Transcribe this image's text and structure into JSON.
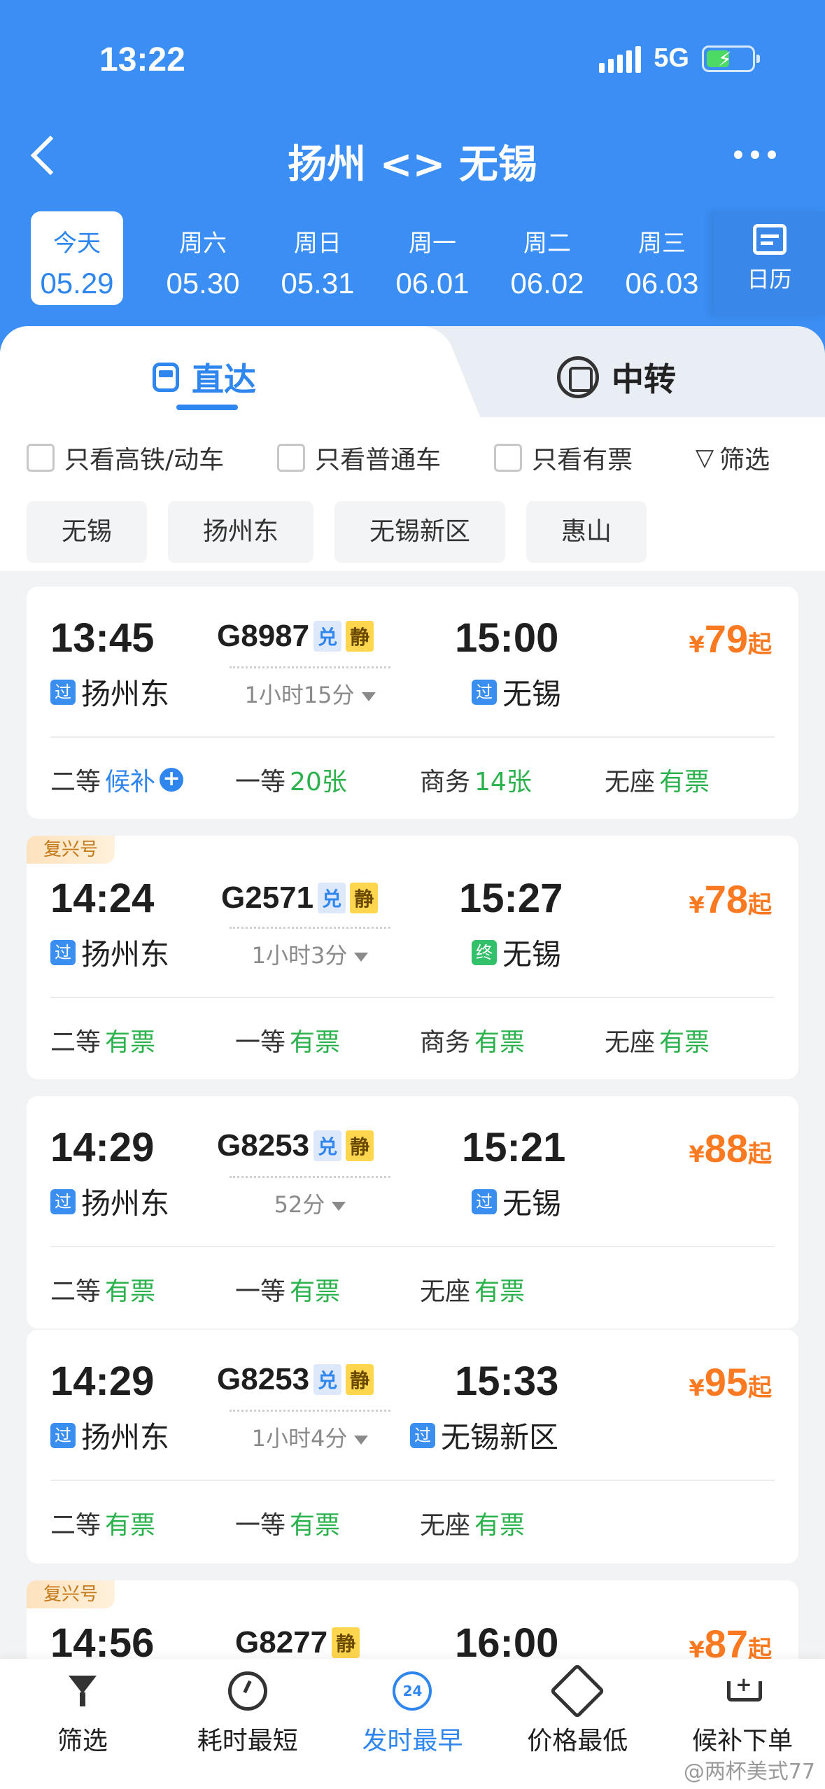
{
  "status": {
    "time": "13:22",
    "network": "5G"
  },
  "header": {
    "title": "扬州 <> 无锡"
  },
  "dates": [
    {
      "weekday": "今天",
      "date": "05.29"
    },
    {
      "weekday": "周六",
      "date": "05.30"
    },
    {
      "weekday": "周日",
      "date": "05.31"
    },
    {
      "weekday": "周一",
      "date": "06.01"
    },
    {
      "weekday": "周二",
      "date": "06.02"
    },
    {
      "weekday": "周三",
      "date": "06.03"
    }
  ],
  "calendar_label": "日历",
  "tabs": {
    "direct": "直达",
    "transfer": "中转"
  },
  "filters": {
    "highspeed": "只看高铁/动车",
    "normal": "只看普通车",
    "available": "只看有票",
    "filter": "筛选"
  },
  "stations": [
    "无锡",
    "扬州东",
    "无锡新区",
    "惠山"
  ],
  "tag_labels": {
    "dui": "兑",
    "jing": "静",
    "fuxing": "复兴号",
    "pass": "过",
    "end": "终",
    "qi": "起",
    "currency": "¥"
  },
  "trains": [
    {
      "dep": "13:45",
      "no": "G8987",
      "arr": "15:00",
      "price": "79",
      "from": "扬州东",
      "to": "无锡",
      "duration": "1小时15分",
      "seats": [
        {
          "cls": "二等",
          "st": "候补"
        },
        {
          "cls": "一等",
          "st": "20张"
        },
        {
          "cls": "商务",
          "st": "14张"
        },
        {
          "cls": "无座",
          "st": "有票"
        }
      ]
    },
    {
      "dep": "14:24",
      "no": "G2571",
      "arr": "15:27",
      "price": "78",
      "from": "扬州东",
      "to": "无锡",
      "duration": "1小时3分",
      "seats": [
        {
          "cls": "二等",
          "st": "有票"
        },
        {
          "cls": "一等",
          "st": "有票"
        },
        {
          "cls": "商务",
          "st": "有票"
        },
        {
          "cls": "无座",
          "st": "有票"
        }
      ]
    },
    {
      "dep": "14:29",
      "no": "G8253",
      "arr": "15:21",
      "price": "88",
      "from": "扬州东",
      "to": "无锡",
      "duration": "52分",
      "seats": [
        {
          "cls": "二等",
          "st": "有票"
        },
        {
          "cls": "一等",
          "st": "有票"
        },
        {
          "cls": "无座",
          "st": "有票"
        }
      ]
    },
    {
      "dep": "14:29",
      "no": "G8253",
      "arr": "15:33",
      "price": "95",
      "from": "扬州东",
      "to": "无锡新区",
      "duration": "1小时4分",
      "seats": [
        {
          "cls": "二等",
          "st": "有票"
        },
        {
          "cls": "一等",
          "st": "有票"
        },
        {
          "cls": "无座",
          "st": "有票"
        }
      ]
    },
    {
      "dep": "14:56",
      "no": "G8277",
      "arr": "16:00",
      "price": "87"
    }
  ],
  "bottom": {
    "filter": "筛选",
    "shortest": "耗时最短",
    "earliest": "发时最早",
    "cheapest": "价格最低",
    "waitlist": "候补下单",
    "badge24": "24"
  },
  "watermark": "@两杯美式77"
}
